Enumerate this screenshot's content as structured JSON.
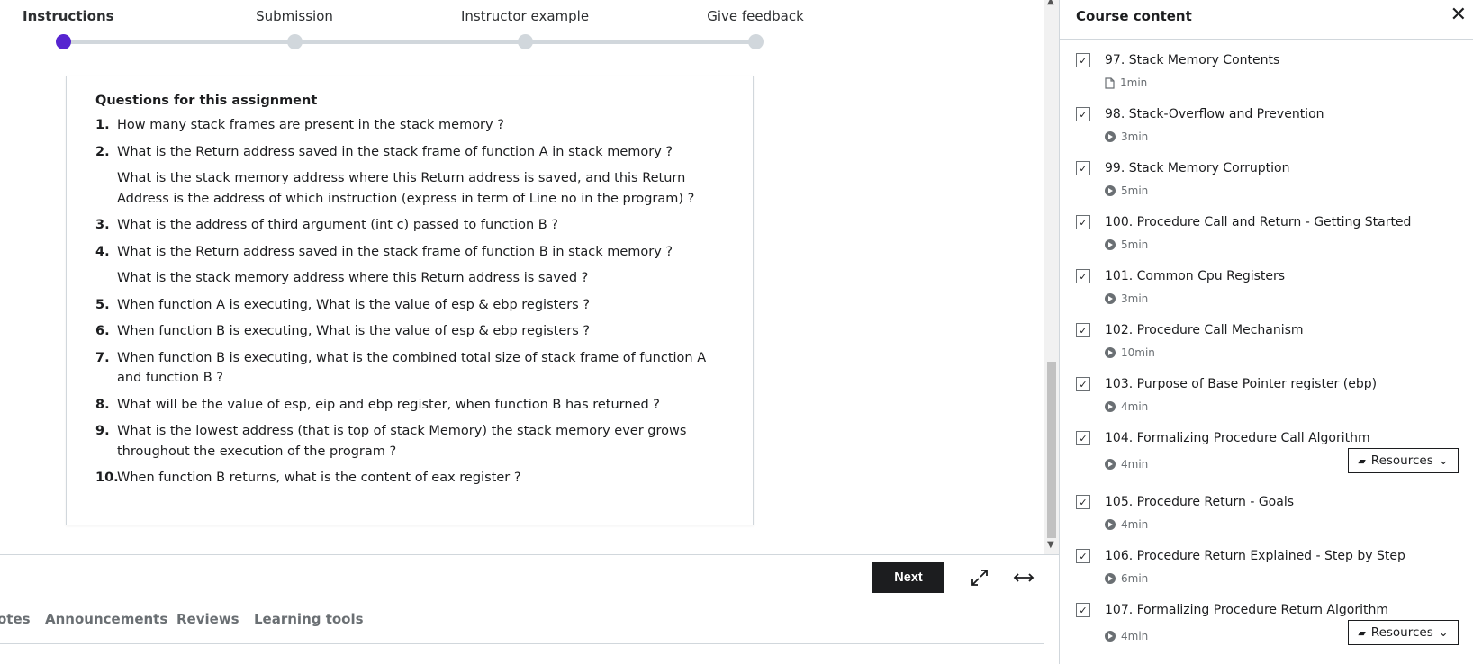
{
  "stepper": {
    "steps": [
      {
        "label": "Instructions",
        "active": true
      },
      {
        "label": "Submission",
        "active": false
      },
      {
        "label": "Instructor example",
        "active": false
      },
      {
        "label": "Give feedback",
        "active": false
      }
    ]
  },
  "assignment": {
    "heading": "Questions for this assignment",
    "questions": [
      {
        "num": "1.",
        "text": "How many stack frames are present in the stack memory ?",
        "sub": ""
      },
      {
        "num": "2.",
        "text": "What is the Return address saved in the stack frame of function A in stack memory ?",
        "sub": "What is the stack memory address where this Return address is saved, and this Return Address is the address of which instruction (express in term of Line no in the program) ?"
      },
      {
        "num": "3.",
        "text": "What is the address of third argument (int c) passed to function B ?",
        "sub": ""
      },
      {
        "num": "4.",
        "text": "What is the Return address saved in the stack frame of function B in stack memory ?",
        "sub": "What is the stack memory address where this Return address is saved ?"
      },
      {
        "num": "5.",
        "text": "When function A is executing, What is the value of esp & ebp registers ?",
        "sub": ""
      },
      {
        "num": "6.",
        "text": "When function B is executing, What is the value of esp & ebp registers ?",
        "sub": ""
      },
      {
        "num": "7.",
        "text": "When function B is executing, what is the combined total size of stack frame of function A and function B ?",
        "sub": ""
      },
      {
        "num": "8.",
        "text": "What will be the value of esp, eip and ebp register,  when function B has returned ?",
        "sub": ""
      },
      {
        "num": "9.",
        "text": "What is the lowest address (that is top of stack Memory) the stack memory ever grows throughout the execution of the program ?",
        "sub": ""
      },
      {
        "num": "10.",
        "text": "When function B returns, what is the content of eax register ?",
        "sub": ""
      }
    ]
  },
  "controls": {
    "next_label": "Next",
    "expand_icon": "expand-icon",
    "widen_icon": "horizontal-arrows-icon"
  },
  "tabs": {
    "items": [
      "otes",
      "Announcements",
      "Reviews",
      "Learning tools"
    ]
  },
  "sidebar": {
    "title": "Course content",
    "close_icon": "close-icon",
    "resources_label": "Resources",
    "lessons": [
      {
        "title": "97. Stack Memory Contents",
        "duration": "1min",
        "kind": "file",
        "resources": false
      },
      {
        "title": "98. Stack-Overflow and Prevention",
        "duration": "3min",
        "kind": "video",
        "resources": false
      },
      {
        "title": "99. Stack Memory Corruption",
        "duration": "5min",
        "kind": "video",
        "resources": false
      },
      {
        "title": "100. Procedure Call and Return - Getting Started",
        "duration": "5min",
        "kind": "video",
        "resources": false
      },
      {
        "title": "101. Common Cpu Registers",
        "duration": "3min",
        "kind": "video",
        "resources": false
      },
      {
        "title": "102. Procedure Call Mechanism",
        "duration": "10min",
        "kind": "video",
        "resources": false
      },
      {
        "title": "103. Purpose of Base Pointer register (ebp)",
        "duration": "4min",
        "kind": "video",
        "resources": false
      },
      {
        "title": "104. Formalizing Procedure Call Algorithm",
        "duration": "4min",
        "kind": "video",
        "resources": true
      },
      {
        "title": "105. Procedure Return - Goals",
        "duration": "4min",
        "kind": "video",
        "resources": false
      },
      {
        "title": "106. Procedure Return Explained - Step by Step",
        "duration": "6min",
        "kind": "video",
        "resources": false
      },
      {
        "title": "107. Formalizing Procedure Return Algorithm",
        "duration": "4min",
        "kind": "video",
        "resources": true
      }
    ]
  },
  "colors": {
    "accent": "#5624d0",
    "track": "#d1d7dc",
    "text": "#1c1d1f",
    "muted": "#6a6f73"
  }
}
